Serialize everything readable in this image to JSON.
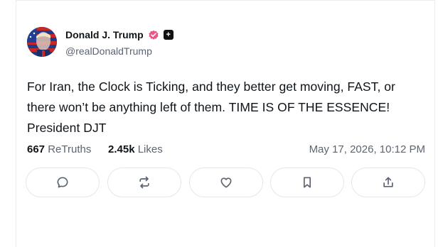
{
  "post": {
    "author": {
      "name": "Donald J. Trump",
      "handle": "@realDonaldTrump",
      "verified_color": "#e8578a",
      "avatar_icon": "avatar-portrait-flag"
    },
    "text": "For Iran, the Clock is Ticking, and they better get moving, FAST, or there won’t be anything left of them. TIME IS OF THE ESSENCE! President DJT",
    "stats": {
      "retruths_count": "667",
      "retruths_label": "ReTruths",
      "likes_count": "2.45k",
      "likes_label": "Likes"
    },
    "timestamp": "May 17, 2026, 10:12 PM"
  },
  "actions": [
    {
      "icon": "reply-icon"
    },
    {
      "icon": "retruth-icon"
    },
    {
      "icon": "like-icon"
    },
    {
      "icon": "bookmark-icon"
    },
    {
      "icon": "share-icon"
    }
  ]
}
